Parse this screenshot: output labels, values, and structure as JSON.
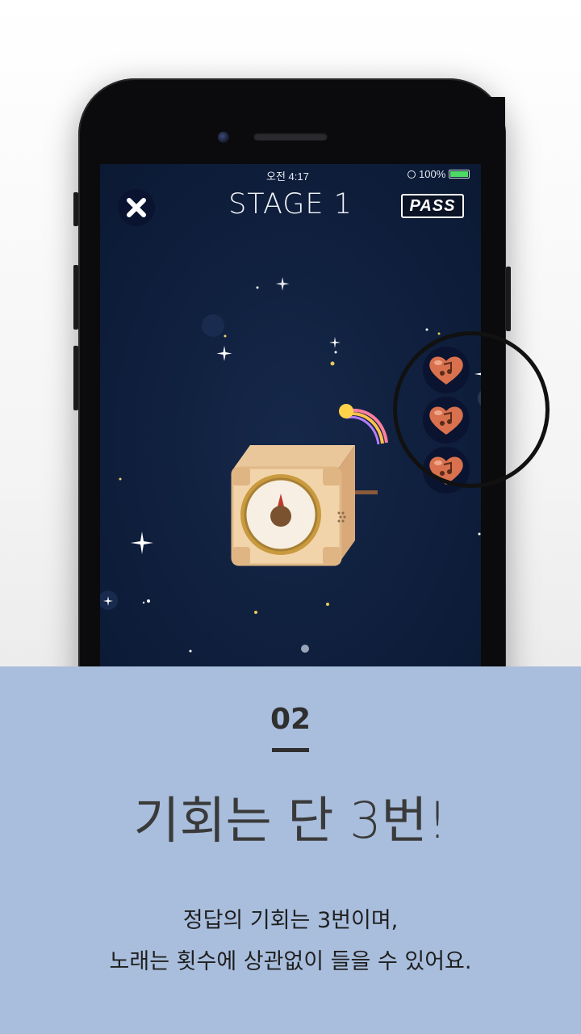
{
  "status_bar": {
    "time": "오전 4:17",
    "battery": "100%"
  },
  "game": {
    "stage_title": "STAGE 1",
    "pass_label": "PASS",
    "lives": [
      {
        "icon": "heart-note-icon"
      },
      {
        "icon": "heart-note-icon"
      },
      {
        "icon": "heart-note-icon"
      }
    ]
  },
  "info": {
    "step_number": "02",
    "headline": "기회는 단 3번!",
    "description_line1": "정답의 기회는 3번이며,",
    "description_line2": "노래는 횟수에 상관없이 들을 수 있어요."
  },
  "colors": {
    "screen_bg": "#0f1f3d",
    "panel_bg": "#a9bedd",
    "heart": "#d9714e",
    "battery": "#4cd964"
  }
}
